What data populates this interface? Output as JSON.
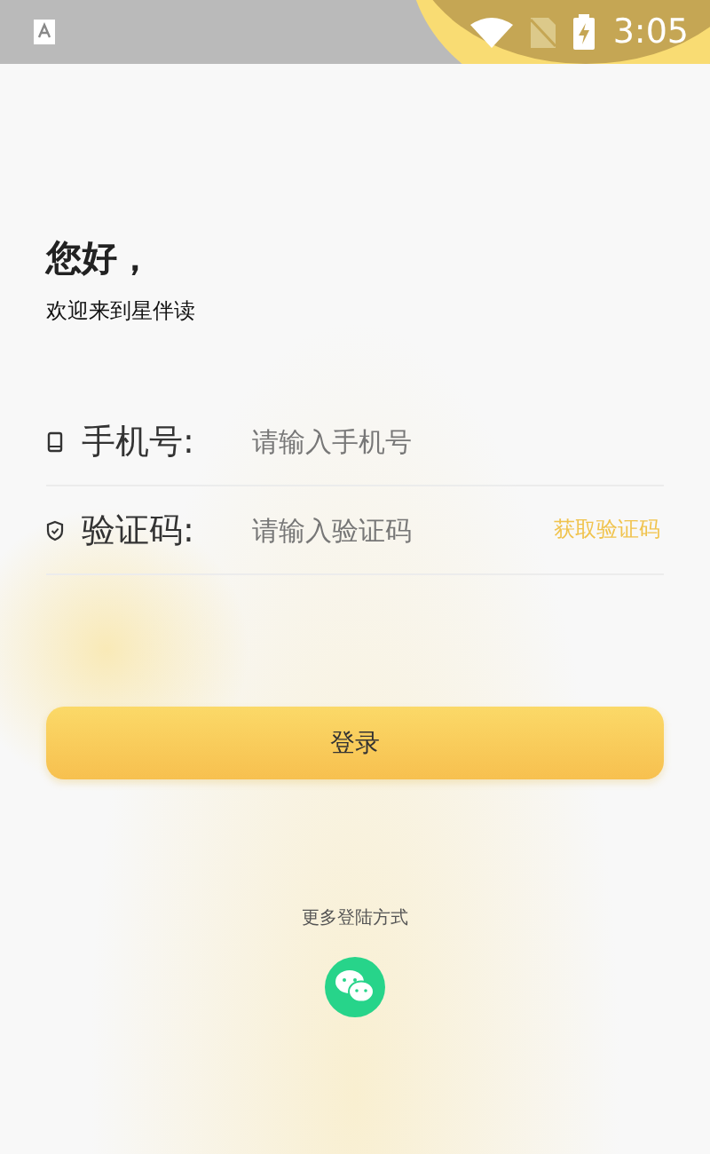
{
  "status_bar": {
    "time": "3:05"
  },
  "greeting": {
    "title": "您好，",
    "subtitle": "欢迎来到星伴读"
  },
  "fields": [
    {
      "kind": "phone",
      "label": "手机号:",
      "placeholder": "请输入手机号"
    },
    {
      "kind": "code",
      "label": "验证码:",
      "placeholder": "请输入验证码",
      "action": "获取验证码"
    }
  ],
  "login_button": "登录",
  "other_login": {
    "label": "更多登陆方式"
  }
}
